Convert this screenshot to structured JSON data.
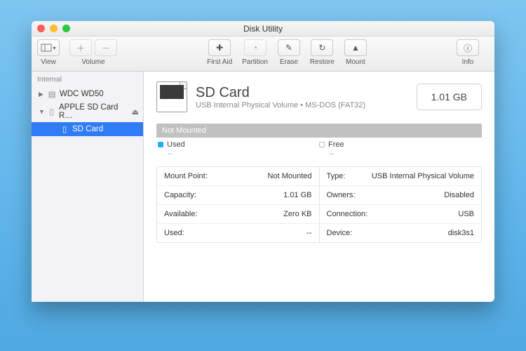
{
  "window": {
    "title": "Disk Utility"
  },
  "toolbar": {
    "view": "View",
    "volume": "Volume",
    "firstaid": "First Aid",
    "partition": "Partition",
    "erase": "Erase",
    "restore": "Restore",
    "mount": "Mount",
    "info": "Info"
  },
  "sidebar": {
    "section": "Internal",
    "items": [
      {
        "label": "WDC WD50",
        "caret": "▶"
      },
      {
        "label": "APPLE SD Card R…",
        "caret": "▼"
      },
      {
        "label": "SD Card"
      }
    ]
  },
  "header": {
    "title": "SD Card",
    "subtitle": "USB Internal Physical Volume • MS-DOS (FAT32)",
    "size": "1.01 GB"
  },
  "status": {
    "label": "Not Mounted"
  },
  "legend": {
    "used_label": "Used",
    "used_value": "--",
    "free_label": "Free",
    "free_value": "--"
  },
  "details": {
    "left": [
      {
        "k": "Mount Point:",
        "v": "Not Mounted"
      },
      {
        "k": "Capacity:",
        "v": "1.01 GB"
      },
      {
        "k": "Available:",
        "v": "Zero KB"
      },
      {
        "k": "Used:",
        "v": "--"
      }
    ],
    "right": [
      {
        "k": "Type:",
        "v": "USB Internal Physical Volume"
      },
      {
        "k": "Owners:",
        "v": "Disabled"
      },
      {
        "k": "Connection:",
        "v": "USB"
      },
      {
        "k": "Device:",
        "v": "disk3s1"
      }
    ]
  }
}
